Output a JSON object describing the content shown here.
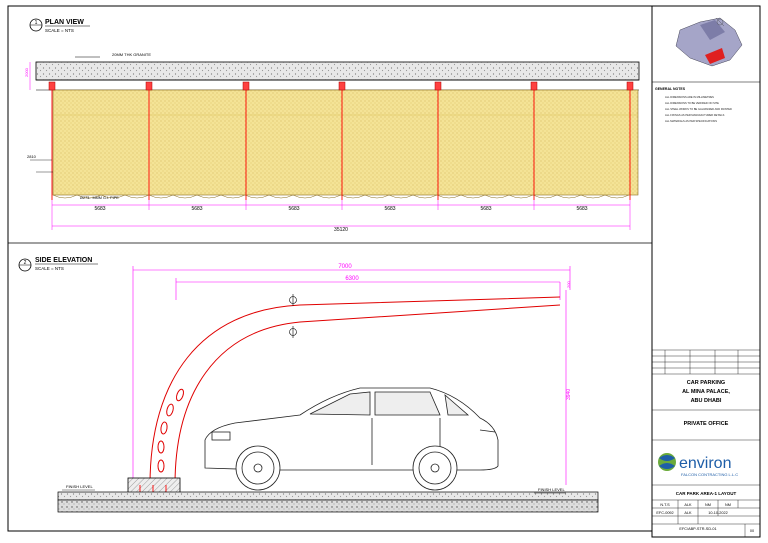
{
  "plan_view": {
    "number": "1",
    "title": "PLAN VIEW",
    "scale": "SCALE = NTS",
    "top_dim": "2000",
    "granite_note": "20MM THK GRANITE",
    "side_dim": "2810",
    "pipe_note": "Ø273.. MMM G.I. PIPE",
    "bay_dims": [
      "5683",
      "5683",
      "5683",
      "5683",
      "5683",
      "5683"
    ],
    "total_dim": "35120"
  },
  "side_elevation": {
    "number": "2",
    "title": "SIDE ELEVATION",
    "scale": "SCALE = NTS",
    "overall_dim": "7000",
    "canopy_dim": "6300",
    "height_dim": "3940",
    "end_dim": "200",
    "finish_level_left": "FINISH LEVEL",
    "finish_level_right": "FINISH LEVEL"
  },
  "general_notes": {
    "heading": "GENERAL NOTES",
    "items": [
      "ALL DIMENSIONS ARE IN MILLIMETRES",
      "ALL DIMENSIONS TO BE VERIFIED ON SITE",
      "ALL STEEL WORKS TO BE GALVANIZED AND PAINTED",
      "ALL FIXINGS AS PER MANUFACTURER DETAILS",
      "ALL MATERIALS AS PER SPECIFICATIONS"
    ]
  },
  "title_block": {
    "project_line1": "CAR PARKING",
    "project_line2": "AL MINA PALACE,",
    "project_line3": "ABU DHABI",
    "client": "PRIVATE OFFICE",
    "company_name": "environ",
    "company_sub": "FALCON CONTRACTING L.L.C",
    "drawing_title": "CAR PARK AREA-1 LAYOUT",
    "scale_value": "N.T.S",
    "drawn_by": "ALK",
    "checked_by": "NM",
    "approved_by": "NM",
    "job_no": "EFC-0092",
    "drawn_by_2": "ALK",
    "date": "10-10-2022",
    "drawing_no": "EFC/ABP-STR-SD-01",
    "revision": "00"
  },
  "colors": {
    "frame": "#000000",
    "dimension": "#ff00ff",
    "structure": "#ff0000",
    "fabric": "#f3e08a",
    "accent_blue": "#1e5ea8",
    "accent_green": "#6aaa3a"
  }
}
